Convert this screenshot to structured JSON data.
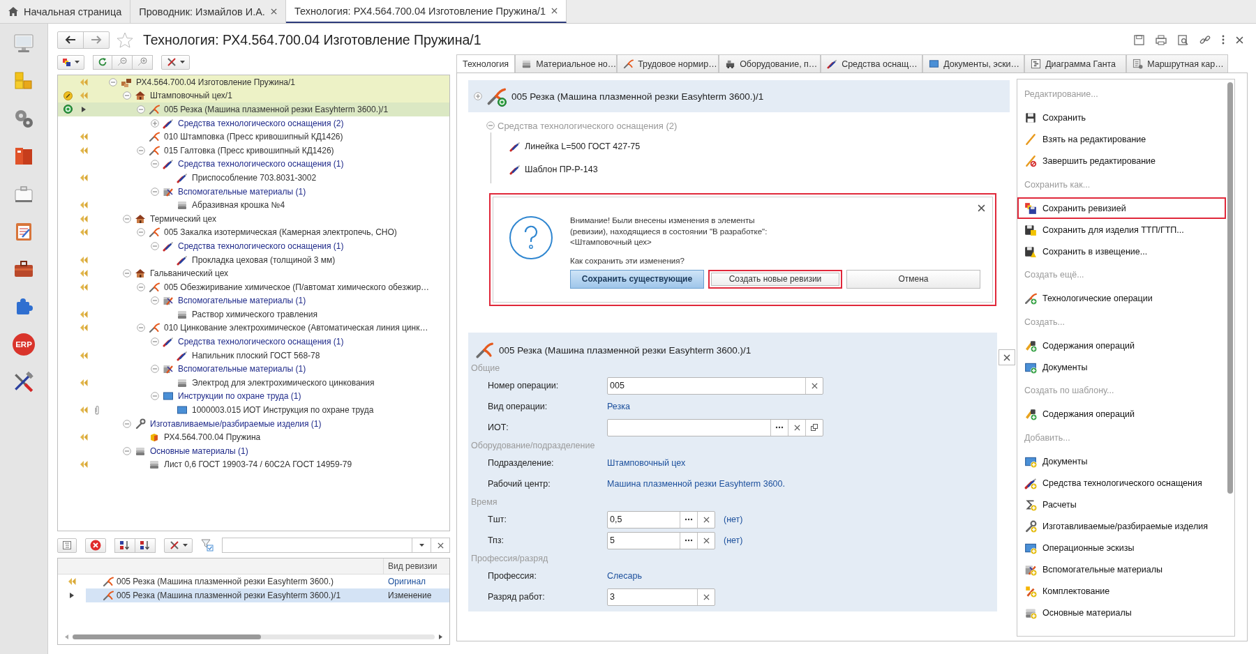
{
  "top_tabs": [
    {
      "label": "Начальная страница",
      "kind": "home",
      "closable": false,
      "selected": false
    },
    {
      "label": "Проводник: Измайлов И.А.",
      "closable": true,
      "selected": false
    },
    {
      "label": "Технология: РХ4.564.700.04 Изготовление Пружина/1",
      "closable": true,
      "selected": true
    }
  ],
  "sidebar": {
    "badge_label": "ERP"
  },
  "window": {
    "title": "Технология: РХ4.564.700.04 Изготовление Пружина/1"
  },
  "tree": [
    {
      "text": "РХ4.564.700.04 Изготовление Пружина/1",
      "kind": "assembly",
      "link": false,
      "arrow": true,
      "highlighted": true,
      "selected": false,
      "expanded": true,
      "children": [
        {
          "text": "Штамповочный цех/1",
          "kind": "workshop",
          "link": false,
          "editing": true,
          "arrow": true,
          "highlighted": true,
          "selected": false,
          "expanded": true,
          "children": [
            {
              "text": "005 Резка (Машина плазменной резки Easyhterm 3600.)/1",
              "kind": "operation",
              "link": false,
              "revised": true,
              "arrow": false,
              "current": true,
              "highlighted": true,
              "selected": true,
              "expanded": true,
              "children": [
                {
                  "text": "Средства технологического оснащения (2)",
                  "kind": "tooling",
                  "link": true,
                  "arrow": false,
                  "highlighted": false,
                  "selected": false,
                  "expanded": false
                }
              ]
            },
            {
              "text": "010 Штамповка (Пресс кривошипный КД1426)",
              "kind": "operation",
              "link": false,
              "arrow": true,
              "highlighted": false,
              "selected": false
            },
            {
              "text": "015 Галтовка (Пресс кривошипный КД1426)",
              "kind": "operation",
              "link": false,
              "arrow": true,
              "highlighted": false,
              "selected": false,
              "expanded": true,
              "children": [
                {
                  "text": "Средства технологического оснащения (1)",
                  "kind": "tooling",
                  "link": true,
                  "arrow": false,
                  "highlighted": false,
                  "selected": false,
                  "expanded": true,
                  "children": [
                    {
                      "text": "Приспособление 703.8031-3002",
                      "kind": "tooling",
                      "link": false,
                      "arrow": true,
                      "highlighted": false,
                      "selected": false
                    }
                  ]
                },
                {
                  "text": "Вспомогательные материалы (1)",
                  "kind": "auxiliary",
                  "link": true,
                  "arrow": false,
                  "highlighted": false,
                  "selected": false,
                  "expanded": true,
                  "children": [
                    {
                      "text": "Абразивная крошка №4",
                      "kind": "material",
                      "link": false,
                      "arrow": true,
                      "highlighted": false,
                      "selected": false
                    }
                  ]
                }
              ]
            }
          ]
        },
        {
          "text": "Термический цех",
          "kind": "workshop",
          "link": false,
          "arrow": true,
          "highlighted": false,
          "selected": false,
          "expanded": true,
          "children": [
            {
              "text": "005 Закалка изотермическая (Камерная электропечь, СНО)",
              "kind": "operation",
              "link": false,
              "arrow": true,
              "highlighted": false,
              "selected": false,
              "expanded": true,
              "children": [
                {
                  "text": "Средства технологического оснащения (1)",
                  "kind": "tooling",
                  "link": true,
                  "arrow": false,
                  "highlighted": false,
                  "selected": false,
                  "expanded": true,
                  "children": [
                    {
                      "text": "Прокладка цеховая (толщиной 3 мм)",
                      "kind": "tooling",
                      "link": false,
                      "arrow": true,
                      "highlighted": false,
                      "selected": false
                    }
                  ]
                }
              ]
            }
          ]
        },
        {
          "text": "Гальванический цех",
          "kind": "workshop",
          "link": false,
          "arrow": true,
          "highlighted": false,
          "selected": false,
          "expanded": true,
          "children": [
            {
              "text": "005 Обезжиривание химическое (П/автомат химического обезжир…",
              "kind": "operation",
              "link": false,
              "arrow": true,
              "highlighted": false,
              "selected": false,
              "expanded": true,
              "children": [
                {
                  "text": "Вспомогательные материалы (1)",
                  "kind": "auxiliary",
                  "link": true,
                  "arrow": false,
                  "highlighted": false,
                  "selected": false,
                  "expanded": true,
                  "children": [
                    {
                      "text": "Раствор химического травления",
                      "kind": "material",
                      "link": false,
                      "arrow": true,
                      "highlighted": false,
                      "selected": false
                    }
                  ]
                }
              ]
            },
            {
              "text": "010 Цинкование электрохимическое (Автоматическая линия цинк…",
              "kind": "operation",
              "link": false,
              "arrow": true,
              "highlighted": false,
              "selected": false,
              "expanded": true,
              "children": [
                {
                  "text": "Средства технологического оснащения (1)",
                  "kind": "tooling",
                  "link": true,
                  "arrow": false,
                  "highlighted": false,
                  "selected": false,
                  "expanded": true,
                  "children": [
                    {
                      "text": "Напильник плоский ГОСТ 568-78",
                      "kind": "tooling",
                      "link": false,
                      "arrow": true,
                      "highlighted": false,
                      "selected": false
                    }
                  ]
                },
                {
                  "text": "Вспомогательные материалы (1)",
                  "kind": "auxiliary",
                  "link": true,
                  "arrow": false,
                  "highlighted": false,
                  "selected": false,
                  "expanded": true,
                  "children": [
                    {
                      "text": "Электрод для электрохимического цинкования",
                      "kind": "material",
                      "link": false,
                      "arrow": true,
                      "highlighted": false,
                      "selected": false
                    }
                  ]
                },
                {
                  "text": "Инструкции по охране труда (1)",
                  "kind": "document",
                  "link": true,
                  "arrow": false,
                  "highlighted": false,
                  "selected": false,
                  "expanded": true,
                  "children": [
                    {
                      "text": "1000003.015 ИОТ Инструкция по охране труда",
                      "kind": "document",
                      "link": false,
                      "arrow": true,
                      "attachment": true,
                      "highlighted": false,
                      "selected": false
                    }
                  ]
                }
              ]
            }
          ]
        },
        {
          "text": "Изготавливаемые/разбираемые изделия (1)",
          "kind": "wrench",
          "link": true,
          "arrow": false,
          "highlighted": false,
          "selected": false,
          "expanded": true,
          "children": [
            {
              "text": "РХ4.564.700.04 Пружина",
              "kind": "part",
              "link": false,
              "arrow": true,
              "highlighted": false,
              "selected": false
            }
          ]
        },
        {
          "text": "Основные материалы (1)",
          "kind": "material",
          "link": true,
          "arrow": false,
          "highlighted": false,
          "selected": false,
          "expanded": true,
          "children": [
            {
              "text": "Лист 0,6  ГОСТ 19903-74 / 60С2А  ГОСТ 14959-79",
              "kind": "material",
              "link": false,
              "arrow": true,
              "highlighted": false,
              "selected": false
            }
          ]
        }
      ]
    }
  ],
  "revisions": {
    "columns": [
      "Вид ревизии"
    ],
    "rows": [
      {
        "arrow": true,
        "current": false,
        "name": "005 Резка (Машина плазменной резки Easyhterm 3600.)",
        "revision": "Оригинал",
        "link": true,
        "selected": false
      },
      {
        "arrow": false,
        "current": true,
        "name": "005 Резка (Машина плазменной резки Easyhterm 3600.)/1",
        "revision": "Изменение",
        "link": false,
        "selected": true
      }
    ]
  },
  "tabs": [
    {
      "label": "Технология",
      "selected": true
    },
    {
      "label": "Материальное но…",
      "kind": "material",
      "selected": false
    },
    {
      "label": "Трудовое нормир…",
      "kind": "operation",
      "selected": false
    },
    {
      "label": "Оборудование, п…",
      "kind": "equipment",
      "selected": false
    },
    {
      "label": "Средства оснащ…",
      "kind": "tooling",
      "selected": false
    },
    {
      "label": "Документы, эски…",
      "kind": "document",
      "selected": false
    },
    {
      "label": "Диаграмма Ганта",
      "kind": "gantt",
      "selected": false
    },
    {
      "label": "Маршрутная кар…",
      "kind": "route",
      "selected": false
    }
  ],
  "operation": {
    "title": "005 Резка (Машина плазменной резки Easyhterm 3600.)/1",
    "expanded": false,
    "revised": true
  },
  "tooling_group": {
    "title": "Средства технологического оснащения (2)",
    "expanded": true,
    "items": [
      "Линейка L=500 ГОСТ 427-75",
      "Шаблон ПР-Р-143"
    ]
  },
  "dialog": {
    "highlighted": true,
    "message": [
      "Внимание! Были внесены изменения в элементы",
      "(ревизии), находящиеся в состоянии \"В разработке\":",
      "<Штамповочный цех>"
    ],
    "question": "Как сохранить эти изменения?",
    "buttons": [
      {
        "label": "Сохранить существующие",
        "default": true,
        "highlighted": false
      },
      {
        "label": "Создать новые ревизии",
        "default": false,
        "highlighted": true
      },
      {
        "label": "Отмена",
        "default": false,
        "highlighted": false
      }
    ]
  },
  "form": {
    "title": "005 Резка (Машина плазменной резки Easyhterm 3600.)/1",
    "sections": [
      {
        "title": "Общие",
        "fields": [
          {
            "label": "Номер операции:",
            "kind": "input",
            "value": "005",
            "clear_button": true
          },
          {
            "label": "Вид операции:",
            "kind": "link",
            "value": "Резка"
          },
          {
            "label": "ИОТ:",
            "kind": "input",
            "select_button": true,
            "clear_button": true,
            "open_button": true
          }
        ]
      },
      {
        "title": "Оборудование/подразделение",
        "fields": [
          {
            "label": "Подразделение:",
            "kind": "link",
            "value": "Штамповочный цех"
          },
          {
            "label": "Рабочий центр:",
            "kind": "link",
            "value": "Машина плазменной резки Easyhterm 3600."
          }
        ]
      },
      {
        "title": "Время",
        "fields": [
          {
            "label": "Тшт:",
            "kind": "input",
            "value": "0,5",
            "select_button": true,
            "clear_button": true,
            "note": "(нет)"
          },
          {
            "label": "Тпз:",
            "kind": "input",
            "value": "5",
            "select_button": true,
            "clear_button": true,
            "note": "(нет)"
          }
        ]
      },
      {
        "title": "Профессия/разряд",
        "fields": [
          {
            "label": "Профессия:",
            "kind": "link",
            "value": "Слесарь"
          },
          {
            "label": "Разряд работ:",
            "kind": "input",
            "value": "3",
            "clear_button": true
          }
        ]
      }
    ]
  },
  "commands": [
    {
      "kind": "header",
      "label": "Редактирование..."
    },
    {
      "kind": "save",
      "label": "Сохранить",
      "highlighted": false
    },
    {
      "kind": "pencil",
      "label": "Взять на редактирование",
      "highlighted": false
    },
    {
      "kind": "pencil-stop",
      "label": "Завершить редактирование",
      "highlighted": false
    },
    {
      "kind": "header",
      "label": "Сохранить как..."
    },
    {
      "kind": "save-revision",
      "label": "Сохранить ревизией",
      "highlighted": true
    },
    {
      "kind": "save-lock",
      "label": "Сохранить для изделия ТТП/ГТП...",
      "highlighted": false
    },
    {
      "kind": "save-bell",
      "label": "Сохранить в извещение...",
      "highlighted": false
    },
    {
      "kind": "header",
      "label": "Создать ещё..."
    },
    {
      "kind": "operation",
      "new_badge": true,
      "label": "Технологические операции",
      "highlighted": false
    },
    {
      "kind": "header",
      "label": "Создать..."
    },
    {
      "kind": "content",
      "new_badge": true,
      "label": "Содержания операций",
      "highlighted": false
    },
    {
      "kind": "document",
      "new_badge": true,
      "label": "Документы",
      "highlighted": false
    },
    {
      "kind": "header",
      "label": "Создать по шаблону..."
    },
    {
      "kind": "content",
      "new_badge": true,
      "label": "Содержания операций",
      "highlighted": false
    },
    {
      "kind": "header",
      "label": "Добавить..."
    },
    {
      "kind": "document",
      "add_badge": true,
      "label": "Документы",
      "highlighted": false
    },
    {
      "kind": "tooling",
      "add_badge": true,
      "label": "Средства технологического оснащения",
      "highlighted": false
    },
    {
      "kind": "sigma",
      "add_badge": true,
      "label": "Расчеты",
      "highlighted": false
    },
    {
      "kind": "wrench",
      "add_badge": true,
      "label": "Изготавливаемые/разбираемые изделия",
      "highlighted": false
    },
    {
      "kind": "document",
      "add_badge": true,
      "label": "Операционные эскизы",
      "highlighted": false
    },
    {
      "kind": "auxiliary",
      "add_badge": true,
      "label": "Вспомогательные материалы",
      "highlighted": false
    },
    {
      "kind": "kit",
      "add_badge": true,
      "label": "Комплектование",
      "highlighted": false
    },
    {
      "kind": "material",
      "add_badge": true,
      "label": "Основные материалы",
      "highlighted": false
    }
  ]
}
